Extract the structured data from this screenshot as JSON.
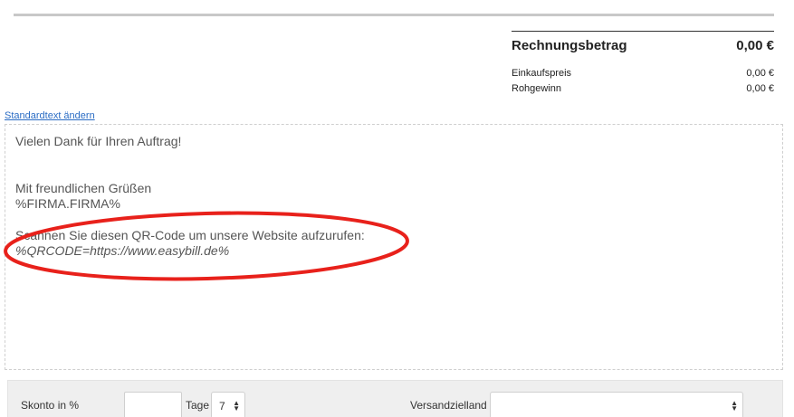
{
  "totals": {
    "title": "Rechnungsbetrag",
    "amount": "0,00 €",
    "rows": [
      {
        "label": "Einkaufspreis",
        "value": "0,00 €"
      },
      {
        "label": "Rohgewinn",
        "value": "0,00 €"
      }
    ]
  },
  "editor": {
    "change_link": "Standardtext ändern",
    "lines": [
      "Vielen Dank für Ihren Auftrag!",
      "Mit freundlichen Grüßen",
      "%FIRMA.FIRMA%",
      "Scannen Sie diesen QR-Code um unsere Website aufzurufen:",
      "%QRCODE=https://www.easybill.de%"
    ]
  },
  "annotation": {
    "color": "#e8211b"
  },
  "footer": {
    "skonto_label": "Skonto in %",
    "skonto_value": "",
    "tage_label": "Tage",
    "tage_value": "7",
    "versand_label": "Versandzielland",
    "versand_value": ""
  }
}
